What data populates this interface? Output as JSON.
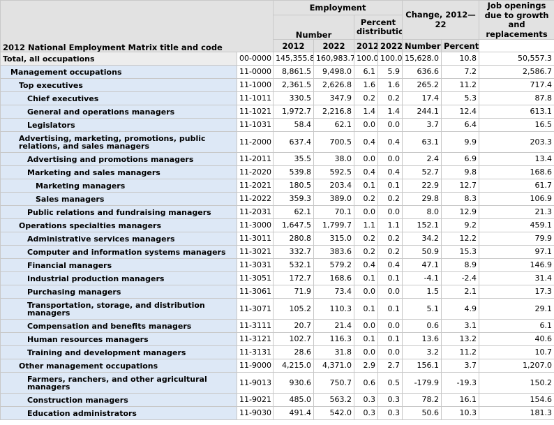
{
  "header": {
    "employment": "Employment",
    "number": "Number",
    "percent_distribution": "Percent distribution",
    "change": "Change, 2012—22",
    "job_openings": "Job openings due to growth and replacements",
    "title_code": "2012 National Employment Matrix title and code",
    "y2012": "2012",
    "y2022": "2022",
    "p2012": "2012",
    "p2022": "2022",
    "change_number": "Number",
    "change_percent": "Percent"
  },
  "rows": [
    {
      "title": "Total, all occupations",
      "code": "00-0000",
      "n2012": "145,355.8",
      "n2022": "160,983.7",
      "p2012": "100.0",
      "p2022": "100.0",
      "chg": "15,628.0",
      "pct": "10.8",
      "jobs": "50,557.3"
    },
    {
      "title": "Management occupations",
      "code": "11-0000",
      "n2012": "8,861.5",
      "n2022": "9,498.0",
      "p2012": "6.1",
      "p2022": "5.9",
      "chg": "636.6",
      "pct": "7.2",
      "jobs": "2,586.7"
    },
    {
      "title": "Top executives",
      "code": "11-1000",
      "n2012": "2,361.5",
      "n2022": "2,626.8",
      "p2012": "1.6",
      "p2022": "1.6",
      "chg": "265.2",
      "pct": "11.2",
      "jobs": "717.4"
    },
    {
      "title": "Chief executives",
      "code": "11-1011",
      "n2012": "330.5",
      "n2022": "347.9",
      "p2012": "0.2",
      "p2022": "0.2",
      "chg": "17.4",
      "pct": "5.3",
      "jobs": "87.8"
    },
    {
      "title": "General and operations managers",
      "code": "11-1021",
      "n2012": "1,972.7",
      "n2022": "2,216.8",
      "p2012": "1.4",
      "p2022": "1.4",
      "chg": "244.1",
      "pct": "12.4",
      "jobs": "613.1"
    },
    {
      "title": "Legislators",
      "code": "11-1031",
      "n2012": "58.4",
      "n2022": "62.1",
      "p2012": "0.0",
      "p2022": "0.0",
      "chg": "3.7",
      "pct": "6.4",
      "jobs": "16.5"
    },
    {
      "title": "Advertising, marketing, promotions, public relations, and sales managers",
      "code": "11-2000",
      "n2012": "637.4",
      "n2022": "700.5",
      "p2012": "0.4",
      "p2022": "0.4",
      "chg": "63.1",
      "pct": "9.9",
      "jobs": "203.3"
    },
    {
      "title": "Advertising and promotions managers",
      "code": "11-2011",
      "n2012": "35.5",
      "n2022": "38.0",
      "p2012": "0.0",
      "p2022": "0.0",
      "chg": "2.4",
      "pct": "6.9",
      "jobs": "13.4"
    },
    {
      "title": "Marketing and sales managers",
      "code": "11-2020",
      "n2012": "539.8",
      "n2022": "592.5",
      "p2012": "0.4",
      "p2022": "0.4",
      "chg": "52.7",
      "pct": "9.8",
      "jobs": "168.6"
    },
    {
      "title": "Marketing managers",
      "code": "11-2021",
      "n2012": "180.5",
      "n2022": "203.4",
      "p2012": "0.1",
      "p2022": "0.1",
      "chg": "22.9",
      "pct": "12.7",
      "jobs": "61.7"
    },
    {
      "title": "Sales managers",
      "code": "11-2022",
      "n2012": "359.3",
      "n2022": "389.0",
      "p2012": "0.2",
      "p2022": "0.2",
      "chg": "29.8",
      "pct": "8.3",
      "jobs": "106.9"
    },
    {
      "title": "Public relations and fundraising managers",
      "code": "11-2031",
      "n2012": "62.1",
      "n2022": "70.1",
      "p2012": "0.0",
      "p2022": "0.0",
      "chg": "8.0",
      "pct": "12.9",
      "jobs": "21.3"
    },
    {
      "title": "Operations specialties managers",
      "code": "11-3000",
      "n2012": "1,647.5",
      "n2022": "1,799.7",
      "p2012": "1.1",
      "p2022": "1.1",
      "chg": "152.1",
      "pct": "9.2",
      "jobs": "459.1"
    },
    {
      "title": "Administrative services managers",
      "code": "11-3011",
      "n2012": "280.8",
      "n2022": "315.0",
      "p2012": "0.2",
      "p2022": "0.2",
      "chg": "34.2",
      "pct": "12.2",
      "jobs": "79.9"
    },
    {
      "title": "Computer and information systems managers",
      "code": "11-3021",
      "n2012": "332.7",
      "n2022": "383.6",
      "p2012": "0.2",
      "p2022": "0.2",
      "chg": "50.9",
      "pct": "15.3",
      "jobs": "97.1"
    },
    {
      "title": "Financial managers",
      "code": "11-3031",
      "n2012": "532.1",
      "n2022": "579.2",
      "p2012": "0.4",
      "p2022": "0.4",
      "chg": "47.1",
      "pct": "8.9",
      "jobs": "146.9"
    },
    {
      "title": "Industrial production managers",
      "code": "11-3051",
      "n2012": "172.7",
      "n2022": "168.6",
      "p2012": "0.1",
      "p2022": "0.1",
      "chg": "-4.1",
      "pct": "-2.4",
      "jobs": "31.4"
    },
    {
      "title": "Purchasing managers",
      "code": "11-3061",
      "n2012": "71.9",
      "n2022": "73.4",
      "p2012": "0.0",
      "p2022": "0.0",
      "chg": "1.5",
      "pct": "2.1",
      "jobs": "17.3"
    },
    {
      "title": "Transportation, storage, and distribution managers",
      "code": "11-3071",
      "n2012": "105.2",
      "n2022": "110.3",
      "p2012": "0.1",
      "p2022": "0.1",
      "chg": "5.1",
      "pct": "4.9",
      "jobs": "29.1"
    },
    {
      "title": "Compensation and benefits managers",
      "code": "11-3111",
      "n2012": "20.7",
      "n2022": "21.4",
      "p2012": "0.0",
      "p2022": "0.0",
      "chg": "0.6",
      "pct": "3.1",
      "jobs": "6.1"
    },
    {
      "title": "Human resources managers",
      "code": "11-3121",
      "n2012": "102.7",
      "n2022": "116.3",
      "p2012": "0.1",
      "p2022": "0.1",
      "chg": "13.6",
      "pct": "13.2",
      "jobs": "40.6"
    },
    {
      "title": "Training and development managers",
      "code": "11-3131",
      "n2012": "28.6",
      "n2022": "31.8",
      "p2012": "0.0",
      "p2022": "0.0",
      "chg": "3.2",
      "pct": "11.2",
      "jobs": "10.7"
    },
    {
      "title": "Other management occupations",
      "code": "11-9000",
      "n2012": "4,215.0",
      "n2022": "4,371.0",
      "p2012": "2.9",
      "p2022": "2.7",
      "chg": "156.1",
      "pct": "3.7",
      "jobs": "1,207.0"
    },
    {
      "title": "Farmers, ranchers, and other agricultural managers",
      "code": "11-9013",
      "n2012": "930.6",
      "n2022": "750.7",
      "p2012": "0.6",
      "p2022": "0.5",
      "chg": "-179.9",
      "pct": "-19.3",
      "jobs": "150.2"
    },
    {
      "title": "Construction managers",
      "code": "11-9021",
      "n2012": "485.0",
      "n2022": "563.2",
      "p2012": "0.3",
      "p2022": "0.3",
      "chg": "78.2",
      "pct": "16.1",
      "jobs": "154.6"
    },
    {
      "title": "Education administrators",
      "code": "11-9030",
      "n2012": "491.4",
      "n2022": "542.0",
      "p2012": "0.3",
      "p2022": "0.3",
      "chg": "50.6",
      "pct": "10.3",
      "jobs": "181.3"
    }
  ]
}
